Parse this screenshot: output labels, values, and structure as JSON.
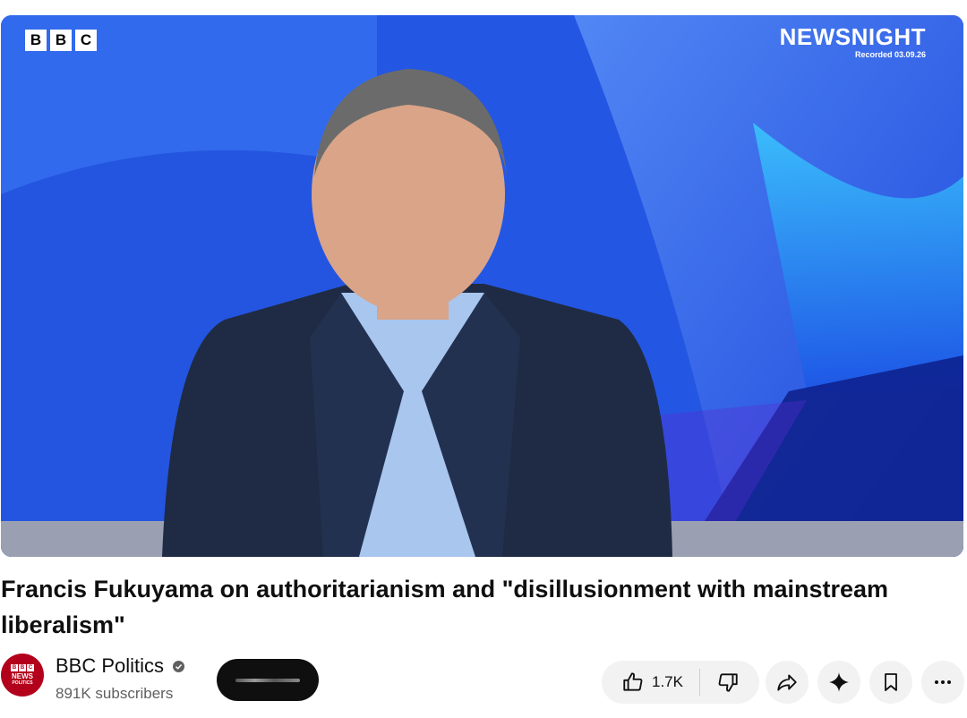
{
  "player": {
    "bbc_letters": [
      "B",
      "B",
      "C"
    ],
    "program_title": "NEWSNIGHT",
    "recorded_label": "Recorded 03.09.26"
  },
  "video": {
    "title": "Francis Fukuyama on authoritarianism and \"disillusionment with mainstream liberalism\""
  },
  "channel": {
    "name": "BBC Politics",
    "subscribers": "891K subscribers",
    "avatar_letters": [
      "B",
      "B",
      "C"
    ],
    "avatar_line1": "NEWS",
    "avatar_line2": "POLITICS",
    "verified": true
  },
  "actions": {
    "like_count": "1.7K",
    "icons": [
      "thumbs-up-icon",
      "thumbs-down-icon",
      "share-icon",
      "sparkle-icon",
      "bookmark-icon",
      "more-icon"
    ]
  },
  "colors": {
    "accent": "#0f0f0f",
    "pill_bg": "#f2f2f2",
    "avatar_bg": "#b3001b",
    "secondary_text": "#606060"
  }
}
